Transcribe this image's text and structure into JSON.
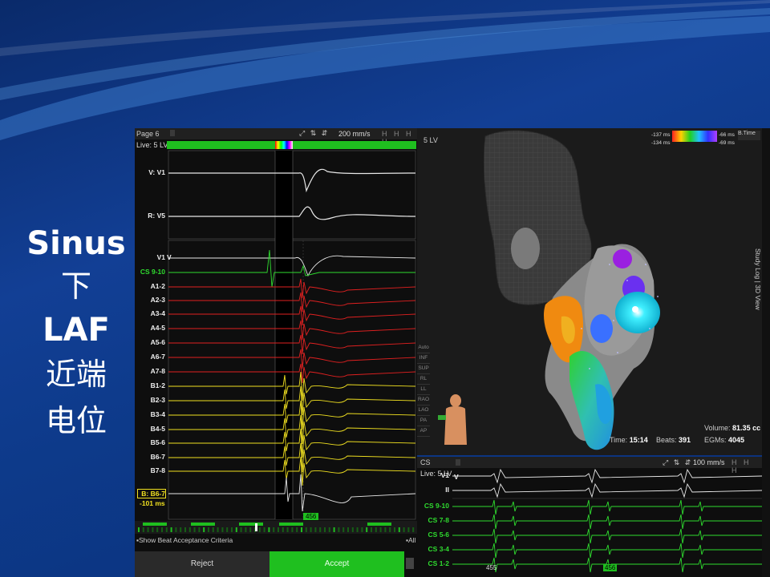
{
  "slide": {
    "caption_lines": [
      "Sinus",
      "下",
      "LAF",
      "近端",
      "电位"
    ]
  },
  "left_panel": {
    "page_label": "Page 6",
    "live_label": "Live: 5 LV",
    "speed": "200 mm/s",
    "header_buttons": "H H H H",
    "signals": [
      {
        "label": "V: V1",
        "color": "#e8e8e8"
      },
      {
        "label": "R: V5",
        "color": "#e8e8e8"
      },
      {
        "label": "V1",
        "color": "#e8e8e8"
      },
      {
        "label": "CS 9-10",
        "color": "#2fdc2f"
      },
      {
        "label": "A1-2",
        "color": "#e02020"
      },
      {
        "label": "A2-3",
        "color": "#e02020"
      },
      {
        "label": "A3-4",
        "color": "#e02020"
      },
      {
        "label": "A4-5",
        "color": "#e02020"
      },
      {
        "label": "A5-6",
        "color": "#e02020"
      },
      {
        "label": "A6-7",
        "color": "#e02020"
      },
      {
        "label": "A7-8",
        "color": "#e02020"
      },
      {
        "label": "B1-2",
        "color": "#f0e020"
      },
      {
        "label": "B2-3",
        "color": "#f0e020"
      },
      {
        "label": "B3-4",
        "color": "#f0e020"
      },
      {
        "label": "B4-5",
        "color": "#f0e020"
      },
      {
        "label": "B5-6",
        "color": "#f0e020"
      },
      {
        "label": "B6-7",
        "color": "#f0e020"
      },
      {
        "label": "B7-8",
        "color": "#f0e020"
      },
      {
        "label": "B: B6-7",
        "color": "#e8e8e8"
      }
    ],
    "v1_marker": "V",
    "ref_value": "-101 ms",
    "cycle_value": "456",
    "criteria_label": "Show Beat Acceptance Criteria",
    "all_label": "All",
    "reject_label": "Reject",
    "accept_label": "Accept",
    "colors": {
      "accept": "#1fbf1f",
      "window": "#000000"
    }
  },
  "map_panel": {
    "map_name": "5 LV",
    "scale_labels": [
      "-137 ms",
      "-134 ms",
      "-66 ms",
      "-69 ms"
    ],
    "time_button": "B.Time",
    "side_label": "Study Log | 3D View",
    "side_buttons": [
      "Auto",
      "INF",
      "SUP",
      "RL",
      "LL",
      "RAO",
      "LAO",
      "PA",
      "AP"
    ],
    "time_label": "Time:",
    "time_value": "15:14",
    "beats_label": "Beats:",
    "beats_value": "391",
    "volume_label": "Volume:",
    "volume_value": "81.35 cc",
    "egms_label": "EGMs:",
    "egms_value": "4045"
  },
  "cs_panel": {
    "title": "CS",
    "live_label": "Live: 5 LV",
    "speed": "100 mm/s",
    "v1_marker": "V",
    "signals": [
      {
        "label": "V1",
        "color": "#e8e8e8"
      },
      {
        "label": "II",
        "color": "#e8e8e8"
      },
      {
        "label": "CS 9-10",
        "color": "#2fdc2f"
      },
      {
        "label": "CS 7-8",
        "color": "#2fdc2f"
      },
      {
        "label": "CS 5-6",
        "color": "#2fdc2f"
      },
      {
        "label": "CS 3-4",
        "color": "#2fdc2f"
      },
      {
        "label": "CS 1-2",
        "color": "#2fdc2f"
      }
    ],
    "interval_left": "455",
    "interval_right": "456"
  }
}
